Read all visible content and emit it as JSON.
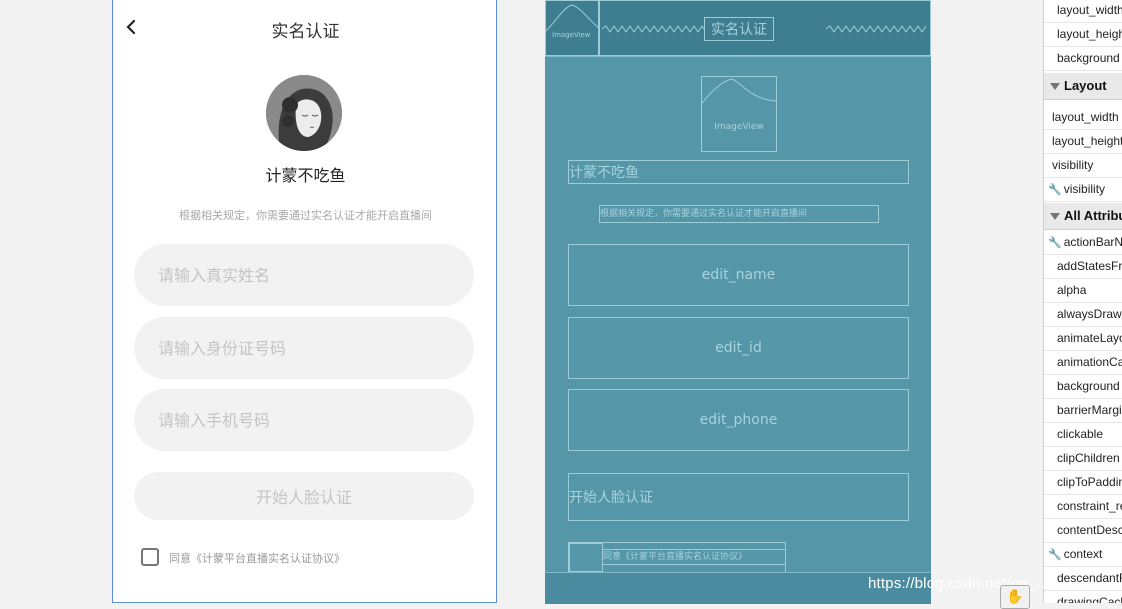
{
  "design": {
    "title": "实名认证",
    "nickname": "计蒙不吃鱼",
    "notice": "根据相关规定，你需要通过实名认证才能开启直播间",
    "inputs": {
      "name_placeholder": "请输入真实姓名",
      "id_placeholder": "请输入身份证号码",
      "phone_placeholder": "请输入手机号码"
    },
    "start_button": "开始人脸认证",
    "agree_text": "同意《计蒙平台直播实名认证协议》"
  },
  "blueprint": {
    "imageview_label": "ImageView",
    "title": "实名认证",
    "nickname": "计蒙不吃鱼",
    "notice": "根据相关规定，你需要通过实名认证才能开启直播间",
    "edit_name": "edit_name",
    "edit_id": "edit_id",
    "edit_phone": "edit_phone",
    "start_button": "开始人脸认证",
    "agree_text": "同意《计蒙平台直播实名认证协议》"
  },
  "attributes": {
    "rows_top": [
      "layout_width",
      "layout_height",
      "background"
    ],
    "layout_header": "Layout",
    "layout_rows": [
      "layout_width",
      "layout_height",
      "visibility",
      "visibility"
    ],
    "all_header": "All Attributes",
    "all_rows": [
      "actionBarNavMode",
      "addStatesFromChildren",
      "alpha",
      "alwaysDrawnWithCache",
      "animateLayoutChanges",
      "animationCache",
      "background",
      "barrierMargin",
      "clickable",
      "clipChildren",
      "clipToPadding",
      "constraint_referenced_ids",
      "contentDescription",
      "context",
      "descendantFocusability",
      "drawingCacheQuality"
    ]
  },
  "watermark": "https://blog.csdn.net/qq_...",
  "colors": {
    "design_border": "#5b8fd8",
    "blueprint_bg": "#5596a8",
    "blueprint_line": "#9ccdd9"
  }
}
